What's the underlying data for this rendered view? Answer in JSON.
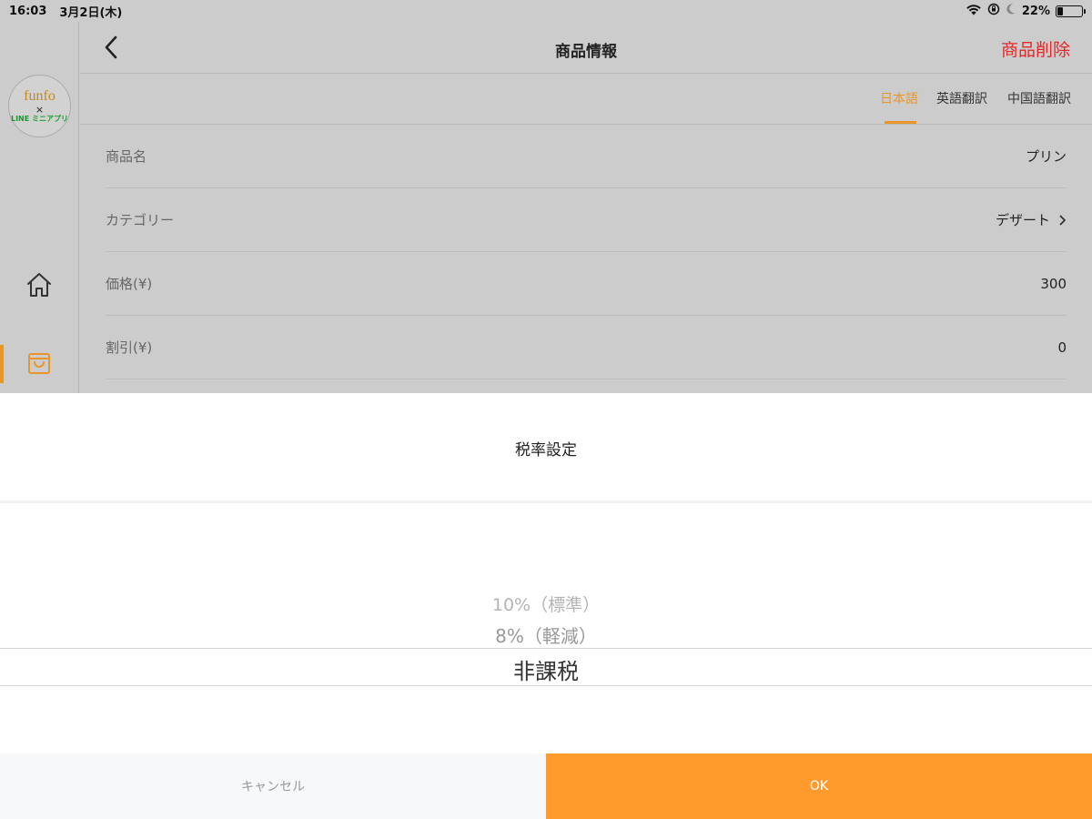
{
  "status_bar": {
    "time": "16:03",
    "date": "3月2日(木)",
    "battery": "22%",
    "battery_level": 0.22,
    "icons": [
      "wifi-icon",
      "orientation-lock-icon",
      "moon-icon",
      "battery-icon"
    ]
  },
  "sidebar": {
    "logo_main": "funfo",
    "logo_x": "×",
    "logo_sub": "LINE ミニアプリ",
    "items": [
      {
        "icon": "home-icon"
      },
      {
        "icon": "shopping-bag-icon",
        "active": true
      }
    ]
  },
  "header": {
    "title": "商品情報",
    "delete_label": "商品削除"
  },
  "tabs": [
    {
      "label": "日本語",
      "active": true
    },
    {
      "label": "英語翻訳"
    },
    {
      "label": "中国語翻訳"
    }
  ],
  "form": {
    "rows": [
      {
        "label": "商品名",
        "value": "プリン"
      },
      {
        "label": "カテゴリー",
        "value": "デザート"
      },
      {
        "label": "価格(¥)",
        "value": "300"
      },
      {
        "label": "割引(¥)",
        "value": "0"
      }
    ]
  },
  "sheet": {
    "title": "税率設定",
    "options": [
      "10%（標準）",
      "8%（軽減）",
      "非課税"
    ],
    "selected": "非課税",
    "cancel_label": "キャンセル",
    "ok_label": "OK"
  },
  "colors": {
    "accent": "#e8952a",
    "ok_button": "#ff9b2c",
    "delete": "#e02a2a",
    "overlay": "#cccccc"
  }
}
